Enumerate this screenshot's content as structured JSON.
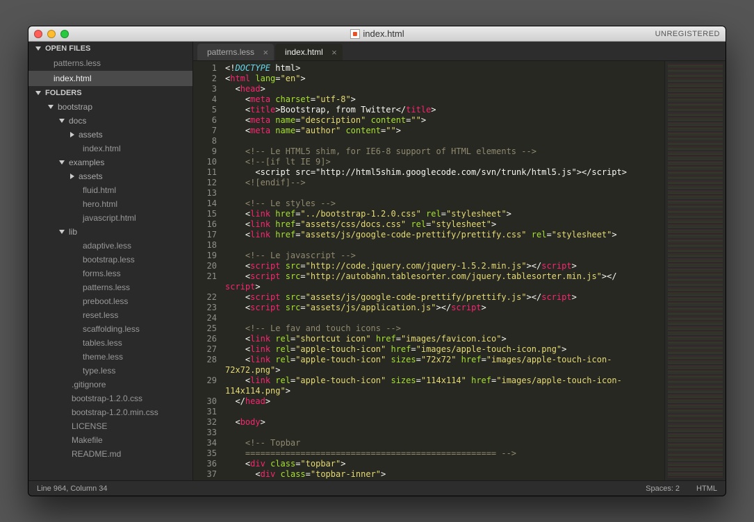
{
  "window": {
    "title": "index.html",
    "unregistered": "UNREGISTERED"
  },
  "sidebar": {
    "openFilesLabel": "OPEN FILES",
    "foldersLabel": "FOLDERS",
    "openFiles": [
      {
        "name": "patterns.less",
        "selected": false
      },
      {
        "name": "index.html",
        "selected": true
      }
    ],
    "tree": {
      "bootstrap": "bootstrap",
      "docs": "docs",
      "docsAssets": "assets",
      "docsIndex": "index.html",
      "examples": "examples",
      "examplesAssets": "assets",
      "fluid": "fluid.html",
      "hero": "hero.html",
      "javascript": "javascript.html",
      "lib": "lib",
      "libFiles": [
        "adaptive.less",
        "bootstrap.less",
        "forms.less",
        "patterns.less",
        "preboot.less",
        "reset.less",
        "scaffolding.less",
        "tables.less",
        "theme.less",
        "type.less"
      ],
      "rootFiles": [
        ".gitignore",
        "bootstrap-1.2.0.css",
        "bootstrap-1.2.0.min.css",
        "LICENSE",
        "Makefile",
        "README.md"
      ]
    }
  },
  "tabs": [
    {
      "label": "patterns.less",
      "active": false
    },
    {
      "label": "index.html",
      "active": true
    }
  ],
  "status": {
    "position": "Line 964, Column 34",
    "spaces": "Spaces: 2",
    "lang": "HTML"
  },
  "code": [
    [
      [
        "b",
        "<!"
      ],
      [
        "d",
        "DOCTYPE"
      ],
      [
        "t",
        " html"
      ],
      [
        "b",
        ">"
      ]
    ],
    [
      [
        "b",
        "<"
      ],
      [
        "r",
        "html"
      ],
      [
        "t",
        " "
      ],
      [
        "a",
        "lang"
      ],
      [
        "o",
        "="
      ],
      [
        "v",
        "\"en\""
      ],
      [
        "b",
        ">"
      ]
    ],
    [
      [
        "t",
        "  "
      ],
      [
        "b",
        "<"
      ],
      [
        "r",
        "head"
      ],
      [
        "b",
        ">"
      ]
    ],
    [
      [
        "t",
        "    "
      ],
      [
        "b",
        "<"
      ],
      [
        "r",
        "meta"
      ],
      [
        "t",
        " "
      ],
      [
        "a",
        "charset"
      ],
      [
        "o",
        "="
      ],
      [
        "v",
        "\"utf-8\""
      ],
      [
        "b",
        ">"
      ]
    ],
    [
      [
        "t",
        "    "
      ],
      [
        "b",
        "<"
      ],
      [
        "r",
        "title"
      ],
      [
        "b",
        ">"
      ],
      [
        "t",
        "Bootstrap, from Twitter"
      ],
      [
        "b",
        "</"
      ],
      [
        "r",
        "title"
      ],
      [
        "b",
        ">"
      ]
    ],
    [
      [
        "t",
        "    "
      ],
      [
        "b",
        "<"
      ],
      [
        "r",
        "meta"
      ],
      [
        "t",
        " "
      ],
      [
        "a",
        "name"
      ],
      [
        "o",
        "="
      ],
      [
        "v",
        "\"description\""
      ],
      [
        "t",
        " "
      ],
      [
        "a",
        "content"
      ],
      [
        "o",
        "="
      ],
      [
        "v",
        "\"\""
      ],
      [
        "b",
        ">"
      ]
    ],
    [
      [
        "t",
        "    "
      ],
      [
        "b",
        "<"
      ],
      [
        "r",
        "meta"
      ],
      [
        "t",
        " "
      ],
      [
        "a",
        "name"
      ],
      [
        "o",
        "="
      ],
      [
        "v",
        "\"author\""
      ],
      [
        "t",
        " "
      ],
      [
        "a",
        "content"
      ],
      [
        "o",
        "="
      ],
      [
        "v",
        "\"\""
      ],
      [
        "b",
        ">"
      ]
    ],
    [],
    [
      [
        "t",
        "    "
      ],
      [
        "c",
        "<!-- Le HTML5 shim, for IE6-8 support of HTML elements -->"
      ]
    ],
    [
      [
        "t",
        "    "
      ],
      [
        "c",
        "<!--[if lt IE 9]>"
      ]
    ],
    [
      [
        "t",
        "      "
      ],
      [
        "t",
        "<script src=\"http://html5shim.googlecode.com/svn/trunk/html5.js\"></script>"
      ]
    ],
    [
      [
        "t",
        "    "
      ],
      [
        "c",
        "<![endif]-->"
      ]
    ],
    [],
    [
      [
        "t",
        "    "
      ],
      [
        "c",
        "<!-- Le styles -->"
      ]
    ],
    [
      [
        "t",
        "    "
      ],
      [
        "b",
        "<"
      ],
      [
        "r",
        "link"
      ],
      [
        "t",
        " "
      ],
      [
        "a",
        "href"
      ],
      [
        "o",
        "="
      ],
      [
        "v",
        "\"../bootstrap-1.2.0.css\""
      ],
      [
        "t",
        " "
      ],
      [
        "a",
        "rel"
      ],
      [
        "o",
        "="
      ],
      [
        "v",
        "\"stylesheet\""
      ],
      [
        "b",
        ">"
      ]
    ],
    [
      [
        "t",
        "    "
      ],
      [
        "b",
        "<"
      ],
      [
        "r",
        "link"
      ],
      [
        "t",
        " "
      ],
      [
        "a",
        "href"
      ],
      [
        "o",
        "="
      ],
      [
        "v",
        "\"assets/css/docs.css\""
      ],
      [
        "t",
        " "
      ],
      [
        "a",
        "rel"
      ],
      [
        "o",
        "="
      ],
      [
        "v",
        "\"stylesheet\""
      ],
      [
        "b",
        ">"
      ]
    ],
    [
      [
        "t",
        "    "
      ],
      [
        "b",
        "<"
      ],
      [
        "r",
        "link"
      ],
      [
        "t",
        " "
      ],
      [
        "a",
        "href"
      ],
      [
        "o",
        "="
      ],
      [
        "v",
        "\"assets/js/google-code-prettify/prettify.css\""
      ],
      [
        "t",
        " "
      ],
      [
        "a",
        "rel"
      ],
      [
        "o",
        "="
      ],
      [
        "v",
        "\"stylesheet\""
      ],
      [
        "b",
        ">"
      ]
    ],
    [],
    [
      [
        "t",
        "    "
      ],
      [
        "c",
        "<!-- Le javascript -->"
      ]
    ],
    [
      [
        "t",
        "    "
      ],
      [
        "b",
        "<"
      ],
      [
        "r",
        "script"
      ],
      [
        "t",
        " "
      ],
      [
        "a",
        "src"
      ],
      [
        "o",
        "="
      ],
      [
        "v",
        "\"http://code.jquery.com/jquery-1.5.2.min.js\""
      ],
      [
        "b",
        ">"
      ],
      [
        "b",
        "</"
      ],
      [
        "r",
        "script"
      ],
      [
        "b",
        ">"
      ]
    ],
    [
      [
        "t",
        "    "
      ],
      [
        "b",
        "<"
      ],
      [
        "r",
        "script"
      ],
      [
        "t",
        " "
      ],
      [
        "a",
        "src"
      ],
      [
        "o",
        "="
      ],
      [
        "v",
        "\"http://autobahn.tablesorter.com/jquery.tablesorter.min.js\""
      ],
      [
        "b",
        ">"
      ],
      [
        "b",
        "</"
      ]
    ],
    [
      [
        "r",
        "script"
      ],
      [
        "b",
        ">"
      ]
    ],
    [
      [
        "t",
        "    "
      ],
      [
        "b",
        "<"
      ],
      [
        "r",
        "script"
      ],
      [
        "t",
        " "
      ],
      [
        "a",
        "src"
      ],
      [
        "o",
        "="
      ],
      [
        "v",
        "\"assets/js/google-code-prettify/prettify.js\""
      ],
      [
        "b",
        ">"
      ],
      [
        "b",
        "</"
      ],
      [
        "r",
        "script"
      ],
      [
        "b",
        ">"
      ]
    ],
    [
      [
        "t",
        "    "
      ],
      [
        "b",
        "<"
      ],
      [
        "r",
        "script"
      ],
      [
        "t",
        " "
      ],
      [
        "a",
        "src"
      ],
      [
        "o",
        "="
      ],
      [
        "v",
        "\"assets/js/application.js\""
      ],
      [
        "b",
        ">"
      ],
      [
        "b",
        "</"
      ],
      [
        "r",
        "script"
      ],
      [
        "b",
        ">"
      ]
    ],
    [],
    [
      [
        "t",
        "    "
      ],
      [
        "c",
        "<!-- Le fav and touch icons -->"
      ]
    ],
    [
      [
        "t",
        "    "
      ],
      [
        "b",
        "<"
      ],
      [
        "r",
        "link"
      ],
      [
        "t",
        " "
      ],
      [
        "a",
        "rel"
      ],
      [
        "o",
        "="
      ],
      [
        "v",
        "\"shortcut icon\""
      ],
      [
        "t",
        " "
      ],
      [
        "a",
        "href"
      ],
      [
        "o",
        "="
      ],
      [
        "v",
        "\"images/favicon.ico\""
      ],
      [
        "b",
        ">"
      ]
    ],
    [
      [
        "t",
        "    "
      ],
      [
        "b",
        "<"
      ],
      [
        "r",
        "link"
      ],
      [
        "t",
        " "
      ],
      [
        "a",
        "rel"
      ],
      [
        "o",
        "="
      ],
      [
        "v",
        "\"apple-touch-icon\""
      ],
      [
        "t",
        " "
      ],
      [
        "a",
        "href"
      ],
      [
        "o",
        "="
      ],
      [
        "v",
        "\"images/apple-touch-icon.png\""
      ],
      [
        "b",
        ">"
      ]
    ],
    [
      [
        "t",
        "    "
      ],
      [
        "b",
        "<"
      ],
      [
        "r",
        "link"
      ],
      [
        "t",
        " "
      ],
      [
        "a",
        "rel"
      ],
      [
        "o",
        "="
      ],
      [
        "v",
        "\"apple-touch-icon\""
      ],
      [
        "t",
        " "
      ],
      [
        "a",
        "sizes"
      ],
      [
        "o",
        "="
      ],
      [
        "v",
        "\"72x72\""
      ],
      [
        "t",
        " "
      ],
      [
        "a",
        "href"
      ],
      [
        "o",
        "="
      ],
      [
        "v",
        "\"images/apple-touch-icon-"
      ]
    ],
    [
      [
        "v",
        "72x72.png\""
      ],
      [
        "b",
        ">"
      ]
    ],
    [
      [
        "t",
        "    "
      ],
      [
        "b",
        "<"
      ],
      [
        "r",
        "link"
      ],
      [
        "t",
        " "
      ],
      [
        "a",
        "rel"
      ],
      [
        "o",
        "="
      ],
      [
        "v",
        "\"apple-touch-icon\""
      ],
      [
        "t",
        " "
      ],
      [
        "a",
        "sizes"
      ],
      [
        "o",
        "="
      ],
      [
        "v",
        "\"114x114\""
      ],
      [
        "t",
        " "
      ],
      [
        "a",
        "href"
      ],
      [
        "o",
        "="
      ],
      [
        "v",
        "\"images/apple-touch-icon-"
      ]
    ],
    [
      [
        "v",
        "114x114.png\""
      ],
      [
        "b",
        ">"
      ]
    ],
    [
      [
        "t",
        "  "
      ],
      [
        "b",
        "</"
      ],
      [
        "r",
        "head"
      ],
      [
        "b",
        ">"
      ]
    ],
    [],
    [
      [
        "t",
        "  "
      ],
      [
        "b",
        "<"
      ],
      [
        "r",
        "body"
      ],
      [
        "b",
        ">"
      ]
    ],
    [],
    [
      [
        "t",
        "    "
      ],
      [
        "c",
        "<!-- Topbar"
      ]
    ],
    [
      [
        "t",
        "    "
      ],
      [
        "c",
        "================================================== -->"
      ]
    ],
    [
      [
        "t",
        "    "
      ],
      [
        "b",
        "<"
      ],
      [
        "r",
        "div"
      ],
      [
        "t",
        " "
      ],
      [
        "a",
        "class"
      ],
      [
        "o",
        "="
      ],
      [
        "v",
        "\"topbar\""
      ],
      [
        "b",
        ">"
      ]
    ],
    [
      [
        "t",
        "      "
      ],
      [
        "b",
        "<"
      ],
      [
        "r",
        "div"
      ],
      [
        "t",
        " "
      ],
      [
        "a",
        "class"
      ],
      [
        "o",
        "="
      ],
      [
        "v",
        "\"topbar-inner\""
      ],
      [
        "b",
        ">"
      ]
    ]
  ],
  "lineNumbers": [
    1,
    2,
    3,
    4,
    5,
    6,
    7,
    8,
    9,
    10,
    11,
    12,
    13,
    14,
    15,
    16,
    17,
    18,
    19,
    20,
    21,
    null,
    22,
    23,
    24,
    25,
    26,
    27,
    28,
    null,
    29,
    null,
    30,
    31,
    32,
    33,
    34,
    35,
    36,
    37
  ]
}
